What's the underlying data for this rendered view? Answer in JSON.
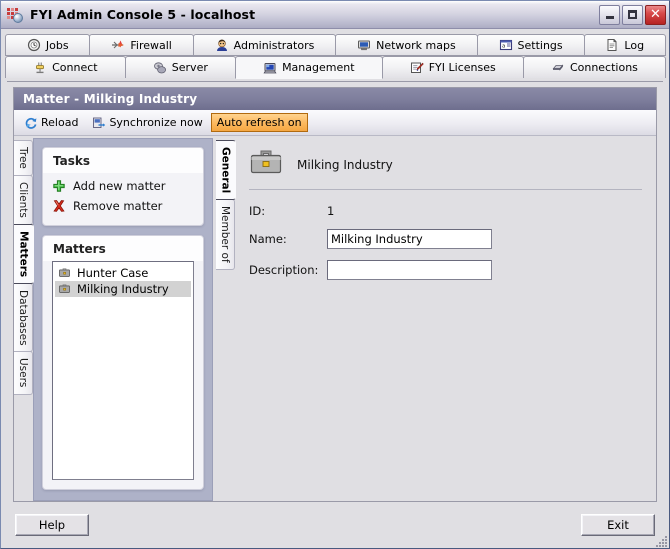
{
  "window": {
    "title": "FYI Admin Console 5 - localhost",
    "app_icon": "app-grid-icon",
    "minimize_label": "",
    "maximize_label": "",
    "close_label": "✕"
  },
  "tabs_row1": [
    {
      "label": "Jobs",
      "icon": "clock-icon",
      "active": false
    },
    {
      "label": "Firewall",
      "icon": "firewall-icon",
      "active": false
    },
    {
      "label": "Administrators",
      "icon": "administrators-icon",
      "active": false
    },
    {
      "label": "Network maps",
      "icon": "network-map-icon",
      "active": false
    },
    {
      "label": "Settings",
      "icon": "settings-icon",
      "active": false
    },
    {
      "label": "Log",
      "icon": "log-document-icon",
      "active": false
    }
  ],
  "tabs_row2": [
    {
      "label": "Connect",
      "icon": "connect-plug-icon",
      "active": false
    },
    {
      "label": "Server",
      "icon": "server-icon",
      "active": false
    },
    {
      "label": "Management",
      "icon": "management-monitor-icon",
      "active": true
    },
    {
      "label": "FYI Licenses",
      "icon": "license-pen-icon",
      "active": false
    },
    {
      "label": "Connections",
      "icon": "connections-chip-icon",
      "active": false
    }
  ],
  "panel": {
    "header_title": "Matter - Milking Industry",
    "toolbar": [
      {
        "label": "Reload",
        "icon": "refresh-icon",
        "toggled": false
      },
      {
        "label": "Synchronize now",
        "icon": "synchronize-icon",
        "toggled": false
      },
      {
        "label": "Auto refresh on",
        "icon": "",
        "toggled": true
      }
    ]
  },
  "left_vtabs": [
    {
      "label": "Tree",
      "active": false
    },
    {
      "label": "Clients",
      "active": false
    },
    {
      "label": "Matters",
      "active": true
    },
    {
      "label": "Databases",
      "active": false
    },
    {
      "label": "Users",
      "active": false
    }
  ],
  "tasks_card": {
    "title": "Tasks",
    "items": [
      {
        "label": "Add new matter",
        "icon": "plus-green-icon"
      },
      {
        "label": "Remove matter",
        "icon": "remove-red-x-icon"
      }
    ]
  },
  "matters_card": {
    "title": "Matters",
    "items": [
      {
        "label": "Hunter Case",
        "icon": "briefcase-icon",
        "selected": false
      },
      {
        "label": "Milking Industry",
        "icon": "briefcase-icon",
        "selected": true
      }
    ]
  },
  "detail_vtabs": [
    {
      "label": "General",
      "active": true
    },
    {
      "label": "Member of",
      "active": false
    }
  ],
  "detail": {
    "icon": "briefcase-large-icon",
    "heading": "Milking Industry",
    "id_label": "ID:",
    "id_value": "1",
    "name_label": "Name:",
    "name_value": "Milking Industry",
    "name_placeholder": "",
    "description_label": "Description:",
    "description_value": "",
    "description_placeholder": ""
  },
  "footer": {
    "help_label": "Help",
    "exit_label": "Exit"
  },
  "colors": {
    "title_gradient_top": "#ffffff",
    "title_gradient_bottom": "#adadc4",
    "panel_header": "#7f7f9d",
    "left_panel_bg": "#aeb2c8",
    "toggle_accent": "#f5a742",
    "close_button": "#b62222",
    "selection": "#d2d2d2"
  }
}
